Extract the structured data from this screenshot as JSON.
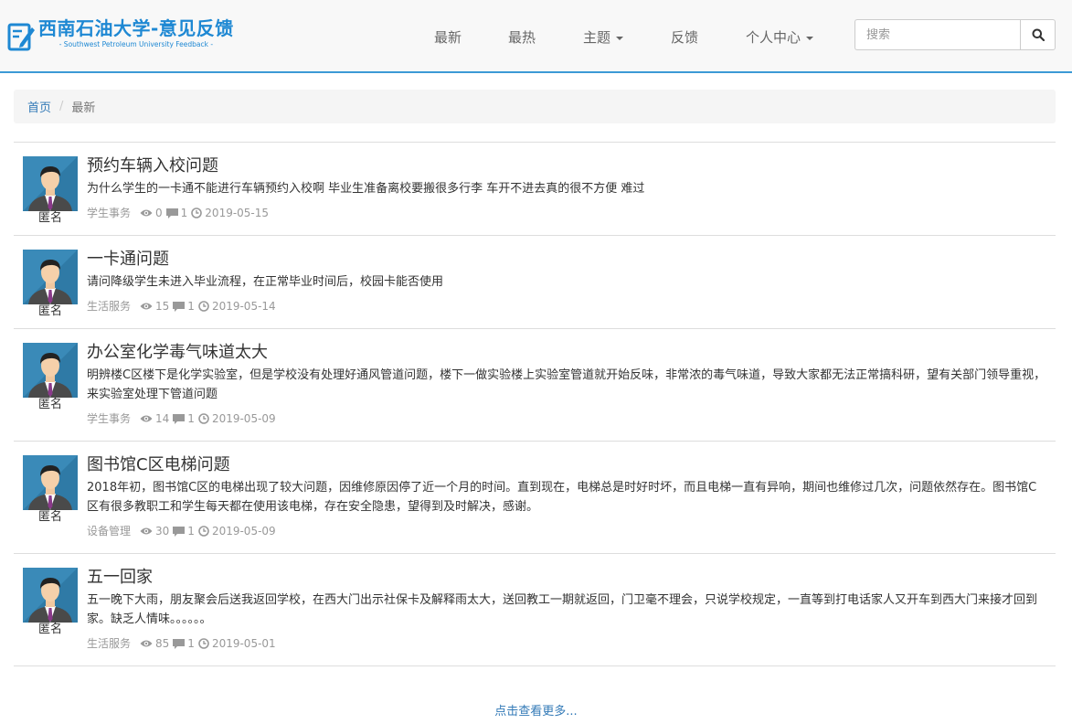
{
  "brand": {
    "title": "西南石油大学-意见反馈",
    "subtitle": "- Southwest Petroleum University Feedback -",
    "color": "#1e88d3"
  },
  "nav": {
    "latest": "最新",
    "hot": "最热",
    "topics": "主题",
    "feedback": "反馈",
    "user_center": "个人中心"
  },
  "search": {
    "placeholder": "搜索",
    "icon": "search-icon"
  },
  "breadcrumb": {
    "home": "首页",
    "current": "最新"
  },
  "posts": [
    {
      "author": "匿名",
      "title": "预约车辆入校问题",
      "body": "为什么学生的一卡通不能进行车辆预约入校啊 毕业生准备离校要搬很多行李 车开不进去真的很不方便 难过",
      "category": "学生事务",
      "views": "0",
      "comments": "1",
      "date": "2019-05-15"
    },
    {
      "author": "匿名",
      "title": "一卡通问题",
      "body": "请问降级学生未进入毕业流程，在正常毕业时间后，校园卡能否使用",
      "category": "生活服务",
      "views": "15",
      "comments": "1",
      "date": "2019-05-14"
    },
    {
      "author": "匿名",
      "title": "办公室化学毒气味道太大",
      "body": "明辨楼C区楼下是化学实验室，但是学校没有处理好通风管道问题，楼下一做实验楼上实验室管道就开始反味，非常浓的毒气味道，导致大家都无法正常搞科研，望有关部门领导重视，来实验室处理下管道问题",
      "category": "学生事务",
      "views": "14",
      "comments": "1",
      "date": "2019-05-09"
    },
    {
      "author": "匿名",
      "title": "图书馆C区电梯问题",
      "body": "2018年初，图书馆C区的电梯出现了较大问题，因维修原因停了近一个月的时间。直到现在，电梯总是时好时坏，而且电梯一直有异响，期间也维修过几次，问题依然存在。图书馆C区有很多教职工和学生每天都在使用该电梯，存在安全隐患，望得到及时解决，感谢。",
      "category": "设备管理",
      "views": "30",
      "comments": "1",
      "date": "2019-05-09"
    },
    {
      "author": "匿名",
      "title": "五一回家",
      "body": "五一晚下大雨，朋友聚会后送我返回学校，在西大门出示社保卡及解释雨太大，送回教工一期就返回，门卫毫不理会，只说学校规定，一直等到打电话家人又开车到西大门来接才回到家。缺乏人情味。。。。。。",
      "category": "生活服务",
      "views": "85",
      "comments": "1",
      "date": "2019-05-01"
    }
  ],
  "load_more": "点击查看更多...",
  "colors": {
    "accent": "#3c9ad6",
    "link": "#337ab7",
    "muted": "#999999"
  }
}
